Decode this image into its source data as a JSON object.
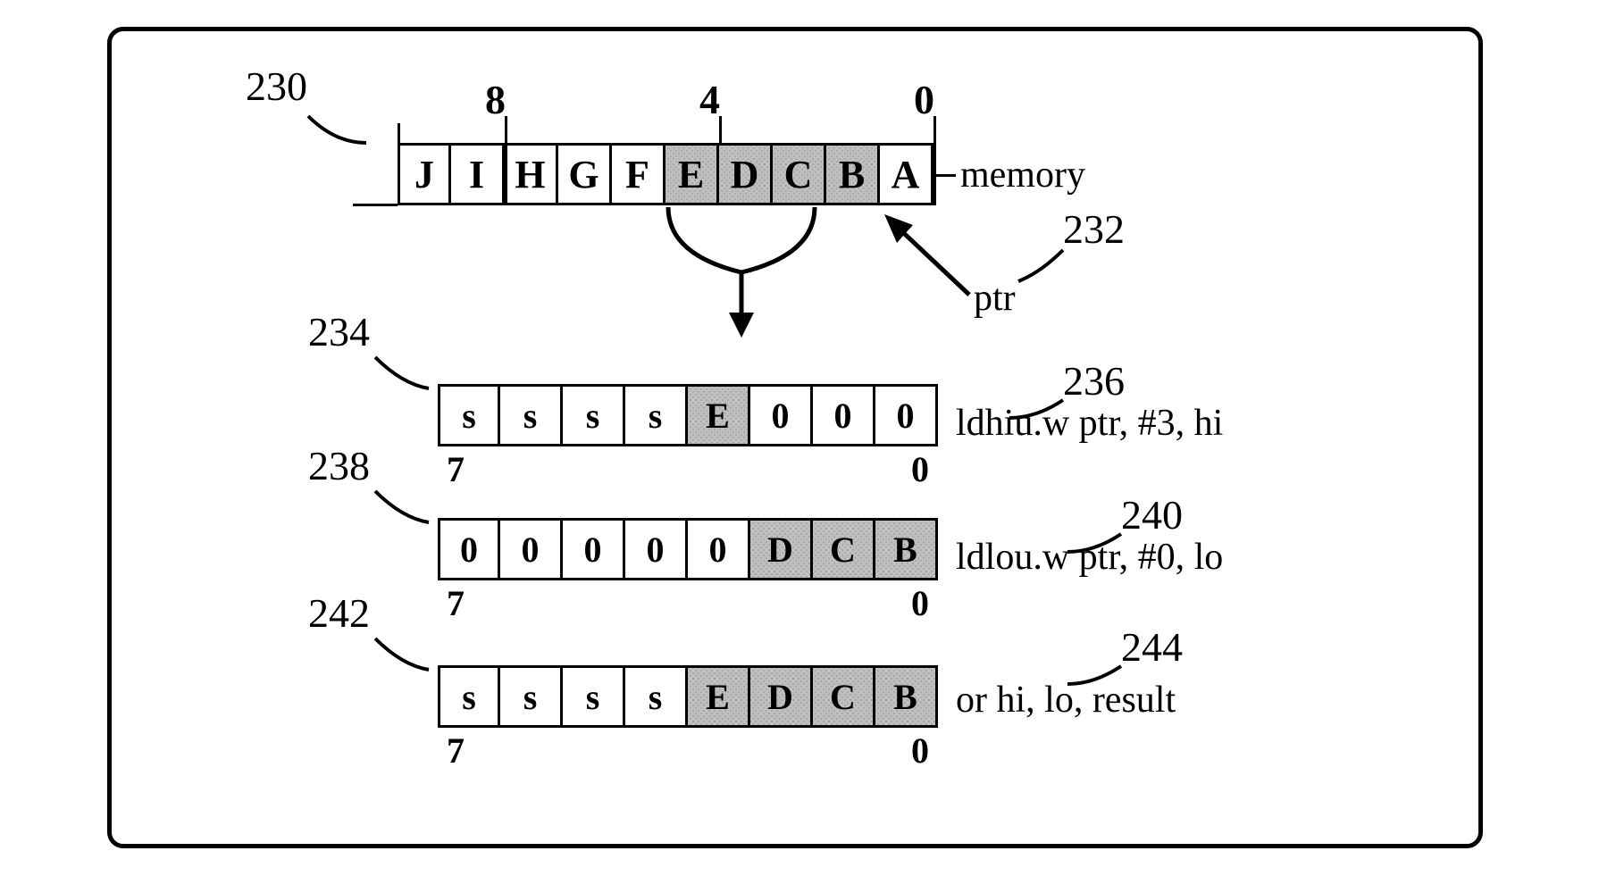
{
  "refs": {
    "n230": "230",
    "n232": "232",
    "n234": "234",
    "n236": "236",
    "n238": "238",
    "n240": "240",
    "n242": "242",
    "n244": "244"
  },
  "memory": {
    "labels": {
      "l8": "8",
      "l4": "4",
      "l0": "0"
    },
    "cells": [
      "J",
      "I",
      "H",
      "G",
      "F",
      "E",
      "D",
      "C",
      "B",
      "A"
    ],
    "shaded": [
      false,
      false,
      false,
      false,
      false,
      true,
      true,
      true,
      true,
      false
    ],
    "caption_memory": "memory",
    "caption_ptr": "ptr"
  },
  "rows": {
    "hi": {
      "cells": [
        "s",
        "s",
        "s",
        "s",
        "E",
        "0",
        "0",
        "0"
      ],
      "shaded": [
        false,
        false,
        false,
        false,
        true,
        false,
        false,
        false
      ],
      "left": "7",
      "right": "0",
      "instr": "ldhiu.w ptr, #3, hi"
    },
    "lo": {
      "cells": [
        "0",
        "0",
        "0",
        "0",
        "0",
        "D",
        "C",
        "B"
      ],
      "shaded": [
        false,
        false,
        false,
        false,
        false,
        true,
        true,
        true
      ],
      "left": "7",
      "right": "0",
      "instr": "ldlou.w ptr, #0, lo"
    },
    "res": {
      "cells": [
        "s",
        "s",
        "s",
        "s",
        "E",
        "D",
        "C",
        "B"
      ],
      "shaded": [
        false,
        false,
        false,
        false,
        true,
        true,
        true,
        true
      ],
      "left": "7",
      "right": "0",
      "instr": "or hi, lo, result"
    }
  }
}
